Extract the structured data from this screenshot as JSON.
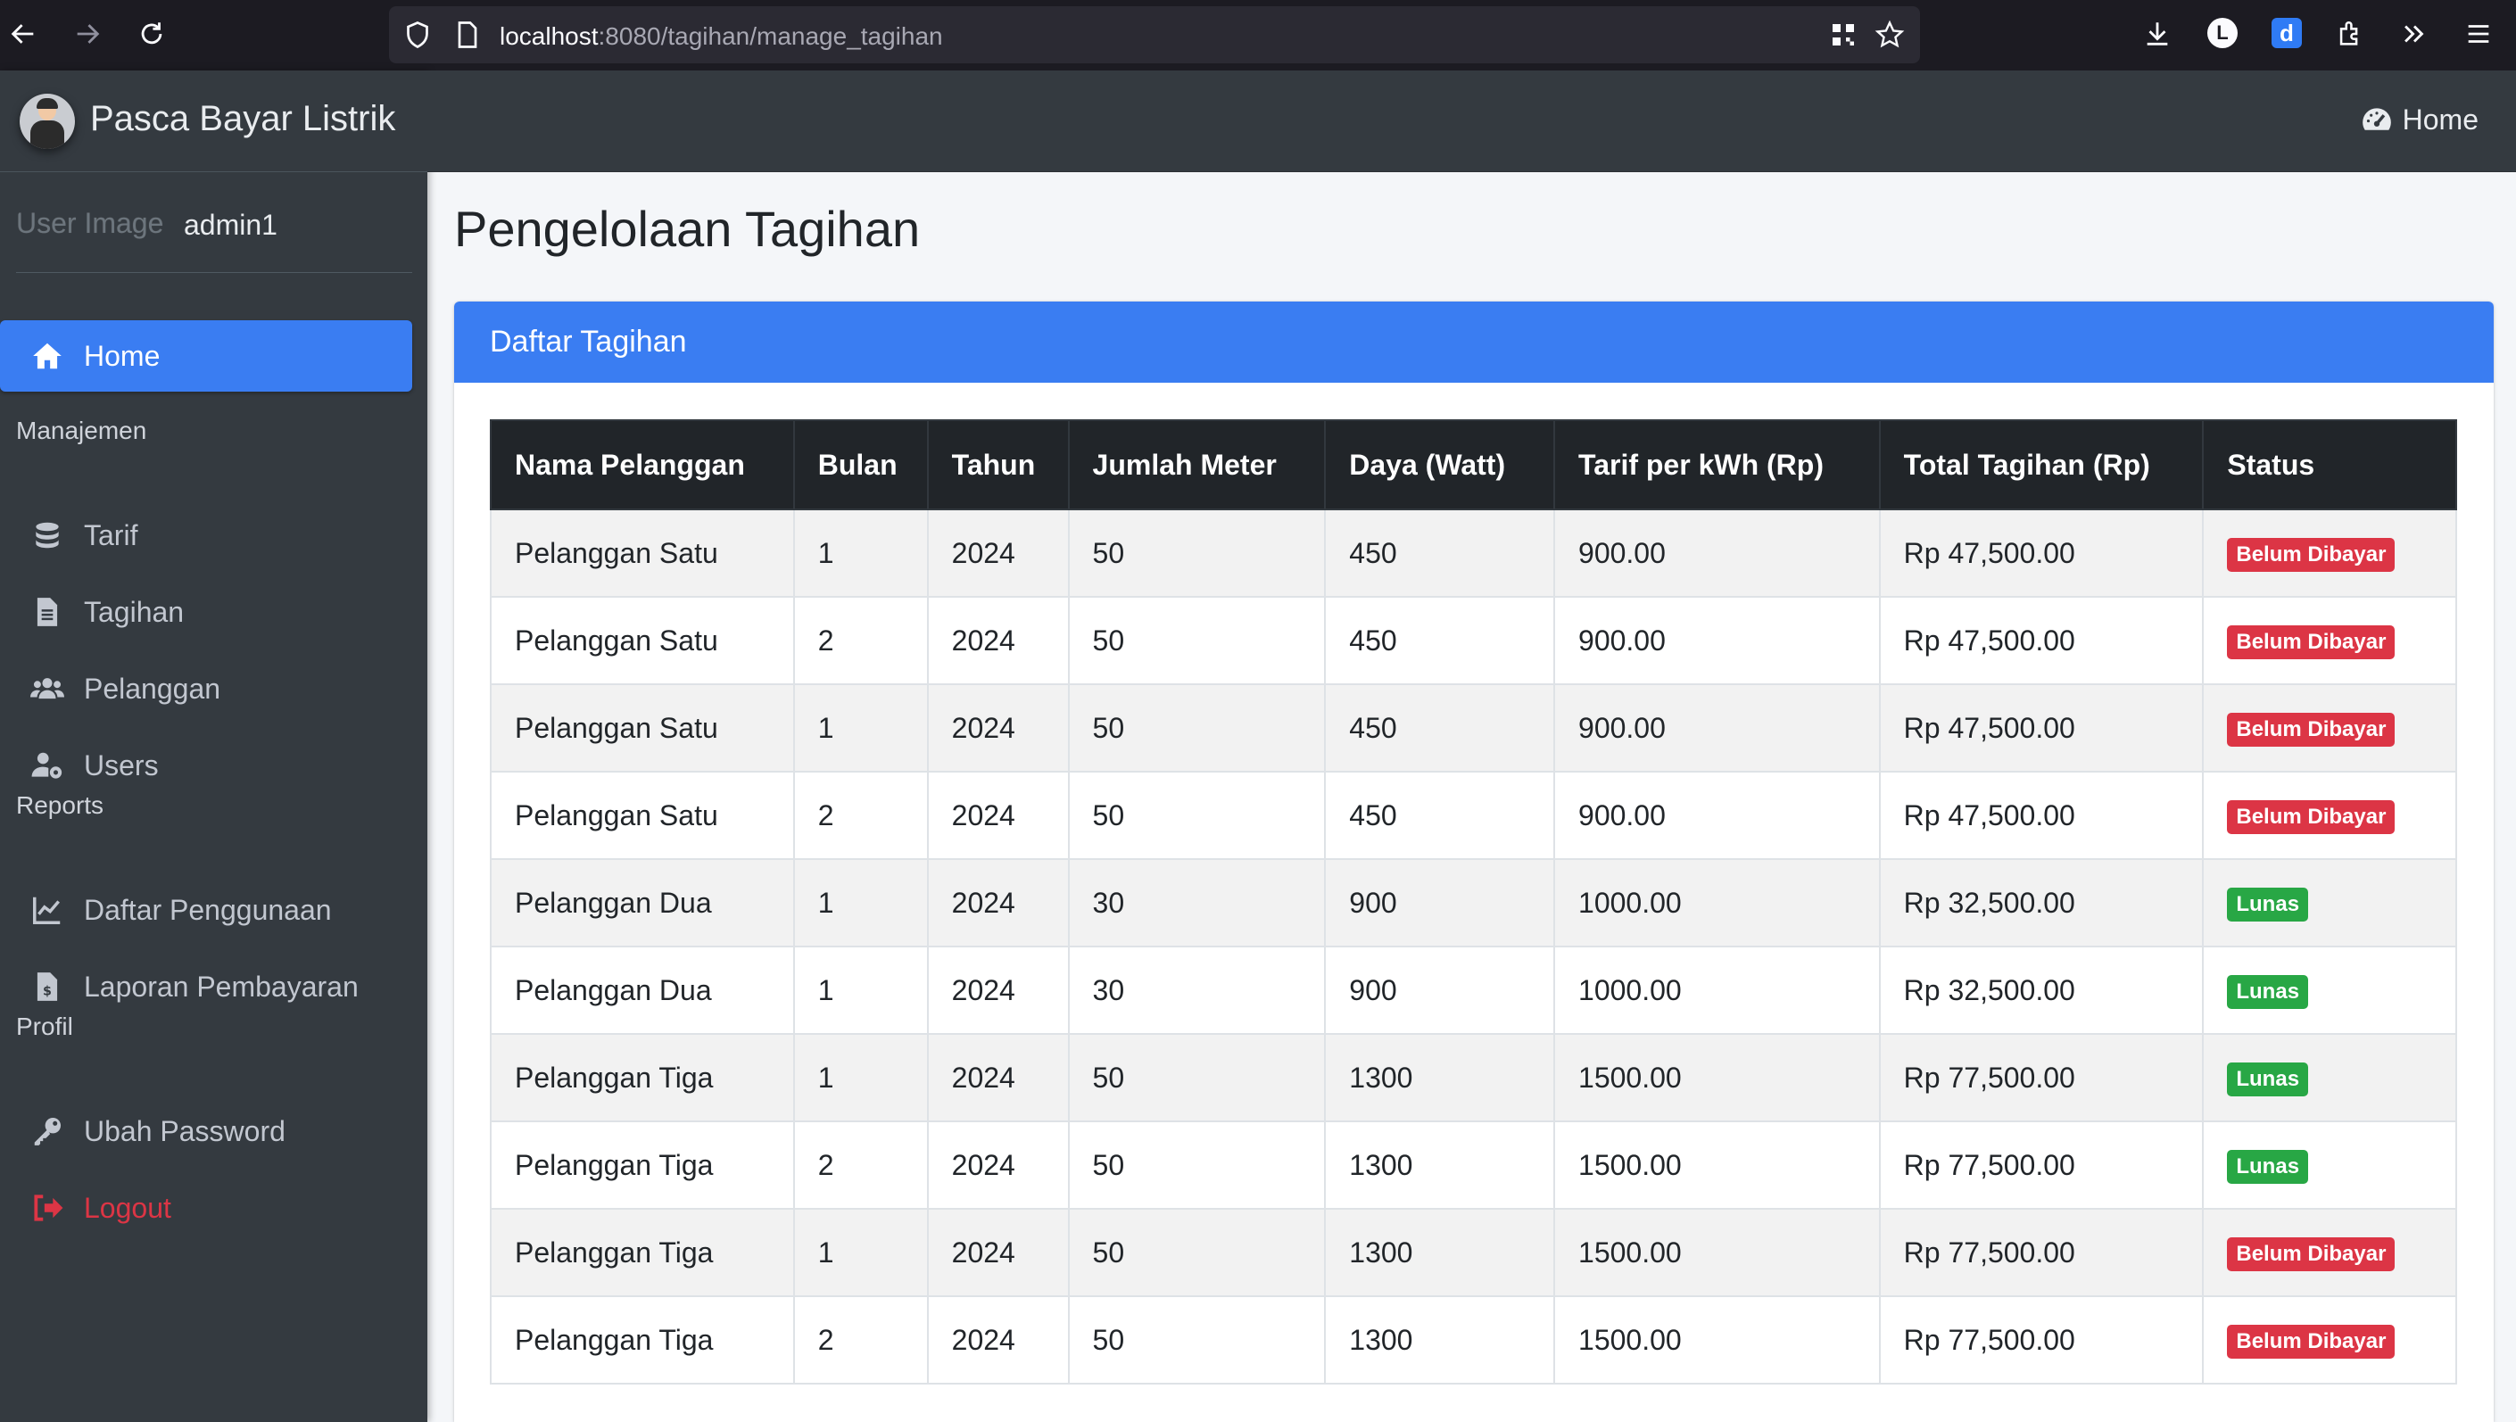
{
  "browser": {
    "url_host": "localhost",
    "url_rest": ":8080/tagihan/manage_tagihan"
  },
  "sidebar": {
    "brand": "Pasca Bayar Listrik",
    "user_image_alt": "User Image",
    "user_name": "admin1",
    "items": [
      {
        "label": "Home",
        "icon": "home-icon"
      },
      {
        "header": "Manajemen"
      },
      {
        "label": "Tarif",
        "icon": "coins-icon"
      },
      {
        "label": "Tagihan",
        "icon": "file-icon"
      },
      {
        "label": "Pelanggan",
        "icon": "users-icon"
      },
      {
        "label": "Users",
        "icon": "user-cog-icon"
      },
      {
        "header": "Reports"
      },
      {
        "label": "Daftar Penggunaan",
        "icon": "chart-line-icon"
      },
      {
        "label": "Laporan Pembayaran",
        "icon": "file-invoice-icon"
      },
      {
        "header": "Profil"
      },
      {
        "label": "Ubah Password",
        "icon": "key-icon"
      },
      {
        "label": "Logout",
        "icon": "sign-out-icon"
      }
    ]
  },
  "navbar": {
    "home_label": "Home"
  },
  "page": {
    "title": "Pengelolaan Tagihan",
    "card_title": "Daftar Tagihan"
  },
  "table": {
    "headers": [
      "Nama Pelanggan",
      "Bulan",
      "Tahun",
      "Jumlah Meter",
      "Daya (Watt)",
      "Tarif per kWh (Rp)",
      "Total Tagihan (Rp)",
      "Status"
    ],
    "rows": [
      [
        "Pelanggan Satu",
        "1",
        "2024",
        "50",
        "450",
        "900.00",
        "Rp 47,500.00",
        "Belum Dibayar"
      ],
      [
        "Pelanggan Satu",
        "2",
        "2024",
        "50",
        "450",
        "900.00",
        "Rp 47,500.00",
        "Belum Dibayar"
      ],
      [
        "Pelanggan Satu",
        "1",
        "2024",
        "50",
        "450",
        "900.00",
        "Rp 47,500.00",
        "Belum Dibayar"
      ],
      [
        "Pelanggan Satu",
        "2",
        "2024",
        "50",
        "450",
        "900.00",
        "Rp 47,500.00",
        "Belum Dibayar"
      ],
      [
        "Pelanggan Dua",
        "1",
        "2024",
        "30",
        "900",
        "1000.00",
        "Rp 32,500.00",
        "Lunas"
      ],
      [
        "Pelanggan Dua",
        "1",
        "2024",
        "30",
        "900",
        "1000.00",
        "Rp 32,500.00",
        "Lunas"
      ],
      [
        "Pelanggan Tiga",
        "1",
        "2024",
        "50",
        "1300",
        "1500.00",
        "Rp 77,500.00",
        "Lunas"
      ],
      [
        "Pelanggan Tiga",
        "2",
        "2024",
        "50",
        "1300",
        "1500.00",
        "Rp 77,500.00",
        "Lunas"
      ],
      [
        "Pelanggan Tiga",
        "1",
        "2024",
        "50",
        "1300",
        "1500.00",
        "Rp 77,500.00",
        "Belum Dibayar"
      ],
      [
        "Pelanggan Tiga",
        "2",
        "2024",
        "50",
        "1300",
        "1500.00",
        "Rp 77,500.00",
        "Belum Dibayar"
      ]
    ]
  },
  "colors": {
    "sidebar_bg": "#343a40",
    "primary": "#3a7df2",
    "danger": "#dc3545",
    "success": "#28a745"
  }
}
